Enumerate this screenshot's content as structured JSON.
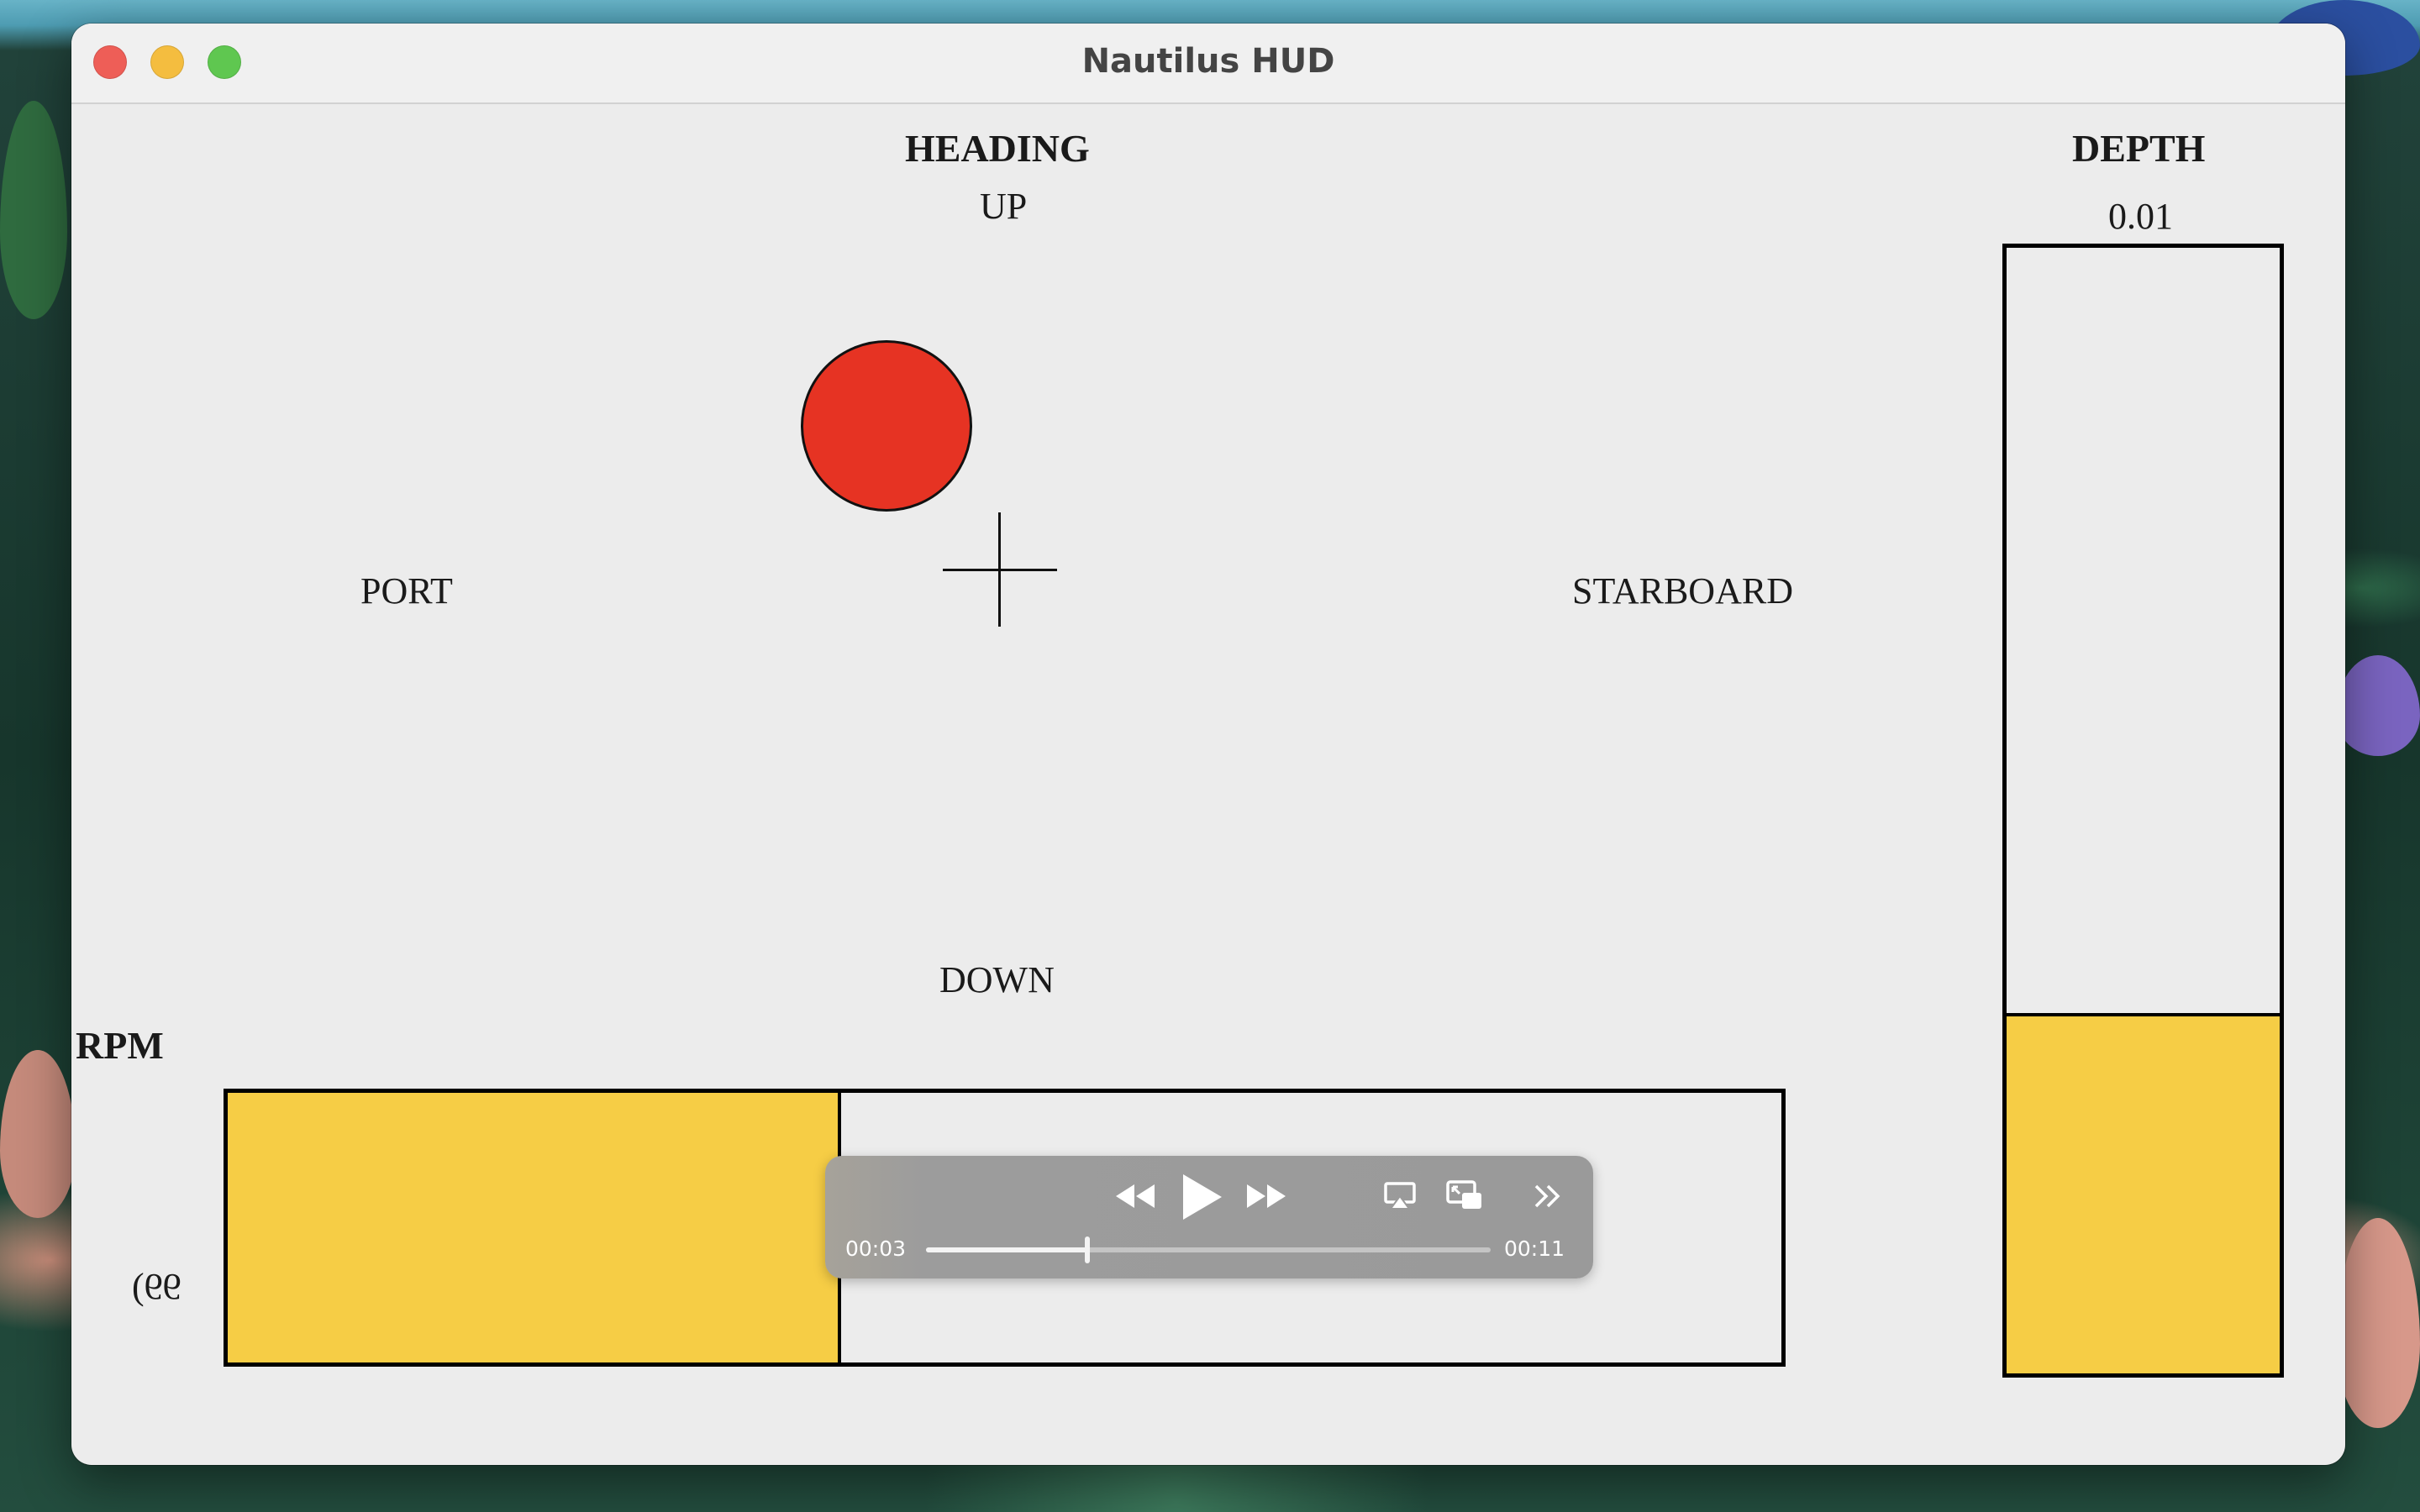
{
  "window": {
    "title": "Nautilus HUD"
  },
  "heading": {
    "title": "HEADING",
    "up": "UP",
    "down": "DOWN",
    "port": "PORT",
    "starboard": "STARBOARD",
    "marker_color": "#e63323"
  },
  "depth": {
    "title": "DEPTH",
    "value": "0.01",
    "fill_fraction": 0.32,
    "fill_color": "#f6cd45"
  },
  "rpm": {
    "title": "RPM",
    "value": "99)",
    "fill_fraction": 0.395,
    "fill_color": "#f6cd45"
  },
  "player": {
    "elapsed": "00:03",
    "remaining": "00:11",
    "progress_fraction": 0.285,
    "buttons": [
      "rewind-icon",
      "play-icon",
      "fast-forward-icon",
      "airplay-icon",
      "picture-in-picture-icon",
      "more-chevrons-icon"
    ]
  }
}
